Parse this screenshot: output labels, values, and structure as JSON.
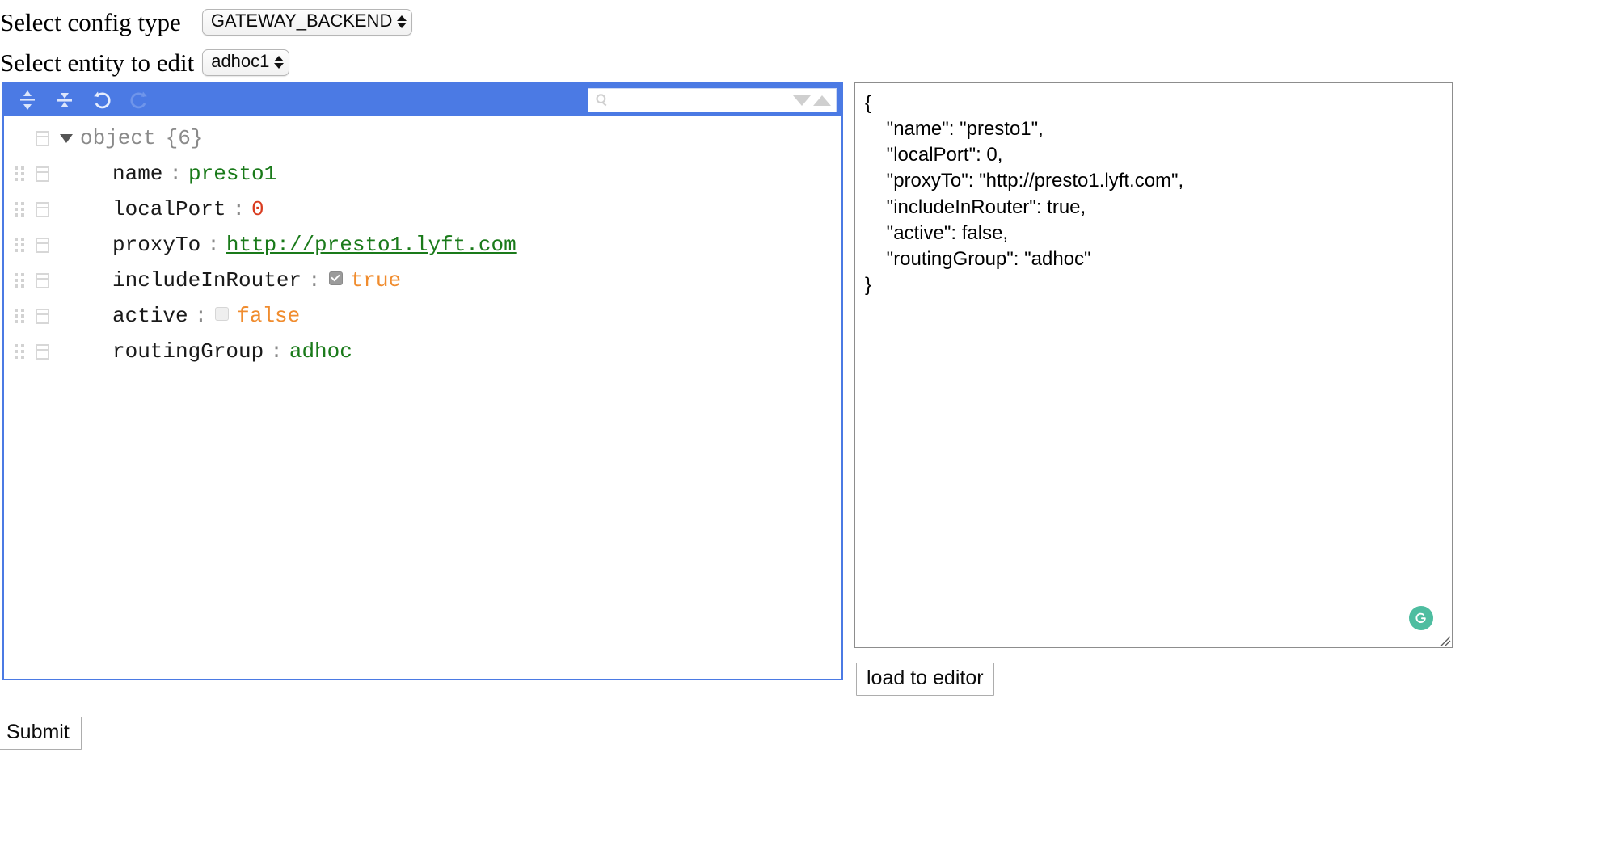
{
  "form": {
    "config_type_label": "Select config type",
    "config_type_value": "GATEWAY_BACKEND",
    "entity_label": "Select entity to edit",
    "entity_value": "adhoc1"
  },
  "tree_editor": {
    "toolbar": {
      "expand_all_icon": "expand-all-icon",
      "collapse_all_icon": "collapse-all-icon",
      "undo_icon": "undo-icon",
      "redo_icon": "redo-icon",
      "accent_color": "#4b7ae4"
    },
    "search": {
      "value": "",
      "placeholder": "",
      "icon": "search-icon",
      "next_icon": "triangle-down-icon",
      "prev_icon": "triangle-up-icon"
    },
    "root": {
      "label": "object",
      "count": "{6}",
      "expanded": true
    },
    "rows": [
      {
        "key": "name",
        "sep": ":",
        "value": "presto1",
        "type": "string"
      },
      {
        "key": "localPort",
        "sep": ":",
        "value": "0",
        "type": "number"
      },
      {
        "key": "proxyTo",
        "sep": ":",
        "value": "http://presto1.lyft.com",
        "type": "url"
      },
      {
        "key": "includeInRouter",
        "sep": ":",
        "value": "true",
        "type": "boolean",
        "checked": true
      },
      {
        "key": "active",
        "sep": ":",
        "value": "false",
        "type": "boolean",
        "checked": false
      },
      {
        "key": "routingGroup",
        "sep": ":",
        "value": "adhoc",
        "type": "string"
      }
    ],
    "colors": {
      "string": "#1a7a1a",
      "number": "#d93b1f",
      "boolean": "#f08c2e",
      "key": "#1a1a1a",
      "root": "#8a8a8a"
    }
  },
  "json_preview": {
    "text": "{\n    \"name\": \"presto1\",\n    \"localPort\": 0,\n    \"proxyTo\": \"http://presto1.lyft.com\",\n    \"includeInRouter\": true,\n    \"active\": false,\n    \"routingGroup\": \"adhoc\"\n}",
    "grammarly_icon": "grammarly-icon",
    "grammarly_letter": "G",
    "grammarly_color": "#4ebda0",
    "resize_icon": "resize-handle-icon"
  },
  "buttons": {
    "load_to_editor": "load to editor",
    "submit": "Submit"
  }
}
